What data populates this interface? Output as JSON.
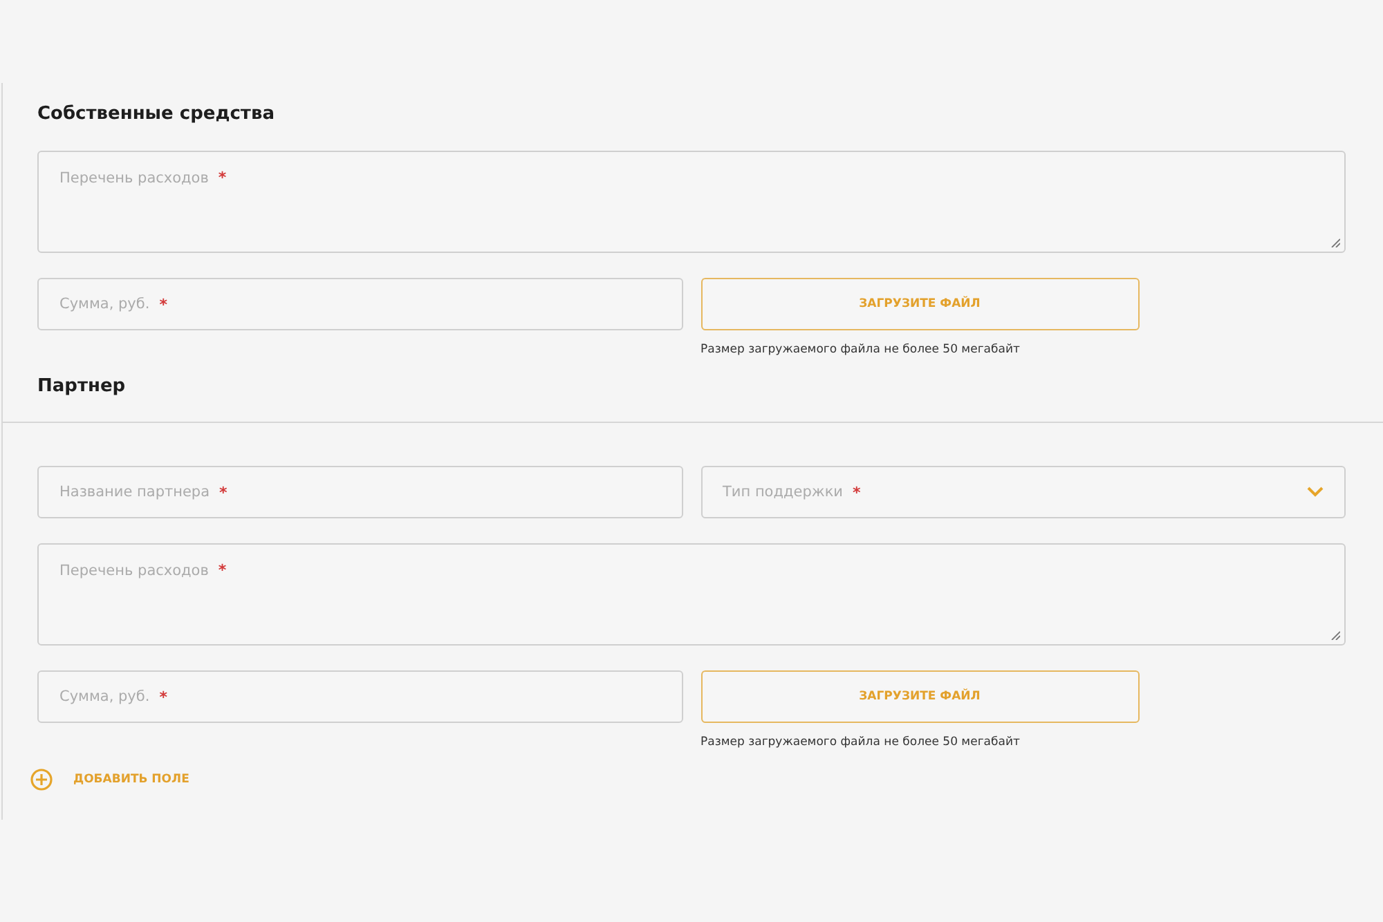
{
  "sections": [
    {
      "title": "Собственные средства",
      "divided": false,
      "rows": [
        [
          {
            "kind": "textarea",
            "placeholder": "Перечень расходов",
            "required_mark": "*"
          }
        ],
        [
          {
            "kind": "input",
            "placeholder": "Сумма, руб.",
            "required_mark": "*"
          },
          {
            "kind": "upload",
            "label": "ЗАГРУЗИТЕ ФАЙЛ",
            "note": "Размер загружаемого файла не более 50 мегабайт"
          }
        ]
      ]
    },
    {
      "title": "Партнер",
      "divided": true,
      "rows": [
        [
          {
            "kind": "input",
            "placeholder": "Название партнера",
            "required_mark": "*"
          },
          {
            "kind": "select",
            "placeholder": "Тип поддержки",
            "required_mark": "*"
          }
        ],
        [
          {
            "kind": "textarea",
            "placeholder": "Перечень расходов",
            "required_mark": "*"
          }
        ],
        [
          {
            "kind": "input",
            "placeholder": "Сумма, руб.",
            "required_mark": "*"
          },
          {
            "kind": "upload",
            "label": "ЗАГРУЗИТЕ ФАЙЛ",
            "note": "Размер загружаемого файла не более 50 мегабайт"
          }
        ]
      ]
    }
  ],
  "add_button": {
    "label": "ДОБАВИТЬ ПОЛЕ"
  }
}
